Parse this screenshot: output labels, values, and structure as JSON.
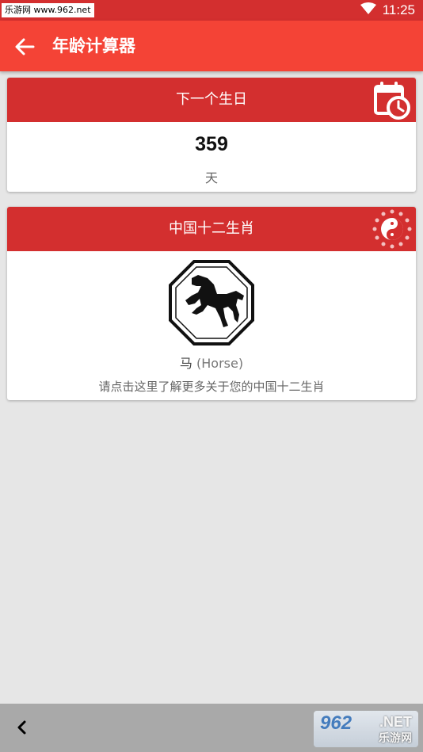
{
  "status_bar": {
    "watermark": "乐游网 www.962.net",
    "time": "11:25",
    "icons": [
      "wifi-icon",
      "battery-icon"
    ]
  },
  "app_bar": {
    "title": "年龄计算器",
    "back_icon": "arrow-left-icon"
  },
  "next_birthday_card": {
    "header": "下一个生日",
    "icon": "calendar-clock-icon",
    "value": "359",
    "unit": "天"
  },
  "zodiac_card": {
    "header": "中国十二生肖",
    "icon": "yin-yang-zodiac-icon",
    "image": "horse-zodiac-icon",
    "animal_cn": "马",
    "animal_en": "(Horse)",
    "hint": "请点击这里了解更多关于您的中国十二生肖"
  },
  "nav_bar": {
    "back_icon": "chevron-left-icon",
    "watermark_big": "962",
    "watermark_net": ".NET",
    "watermark_sub": "乐游网"
  },
  "colors": {
    "status_bar": "#d32f2f",
    "app_bar": "#f44336",
    "card_header": "#d32f2f",
    "background": "#e6e6e6"
  }
}
